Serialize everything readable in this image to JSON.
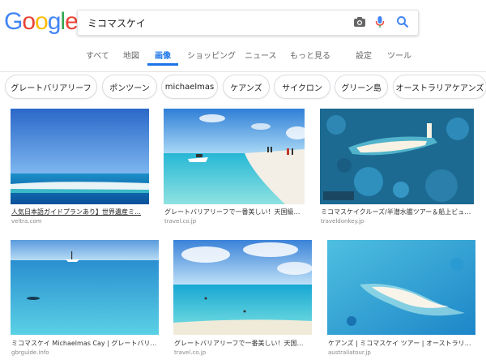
{
  "logo": {
    "letters": [
      "G",
      "o",
      "o",
      "g",
      "l",
      "e"
    ],
    "colors": [
      "#4285F4",
      "#EA4335",
      "#FBBC05",
      "#4285F4",
      "#34A853",
      "#EA4335"
    ]
  },
  "search": {
    "query": "ミコマスケイ",
    "camera_icon": "camera-icon",
    "mic_icon": "mic-icon",
    "search_icon": "search-icon"
  },
  "tabs": [
    "すべて",
    "地図",
    "画像",
    "ショッピング",
    "ニュース",
    "もっと見る",
    "設定",
    "ツール"
  ],
  "active_tab": "画像",
  "chips": [
    "グレートバリアリーフ",
    "ポンツーン",
    "michaelmas",
    "ケアンズ",
    "サイクロン",
    "グリーン島",
    "オーストラリアケアンズ"
  ],
  "results": [
    {
      "caption": "人気日本語ガイドプランあり】世界遺産ミ…",
      "source": "veltra.com",
      "underlined": true
    },
    {
      "caption": "グレートバリアリーフで一番美しい！天国級…",
      "source": "travel.co.jp"
    },
    {
      "caption": "ミコマスケイクルーズ/半潜水艦ツアー＆船上ビュ…",
      "source": "traveldonkey.jp"
    },
    {
      "caption": "ミコマスケイ Michaelmas Cay | グレートバリ…",
      "source": "gbrguide.info"
    },
    {
      "caption": "グレートバリアリーフで一番美しい！天国…",
      "source": "travel.co.jp"
    },
    {
      "caption": "ケアンズ | ミコマスケイ ツアー | オーストラリ…",
      "source": "australiatour.jp"
    }
  ],
  "colors": {
    "accent": "#1a73e8",
    "sea": "#1ea0d6",
    "sky": "#6fb8ea"
  }
}
